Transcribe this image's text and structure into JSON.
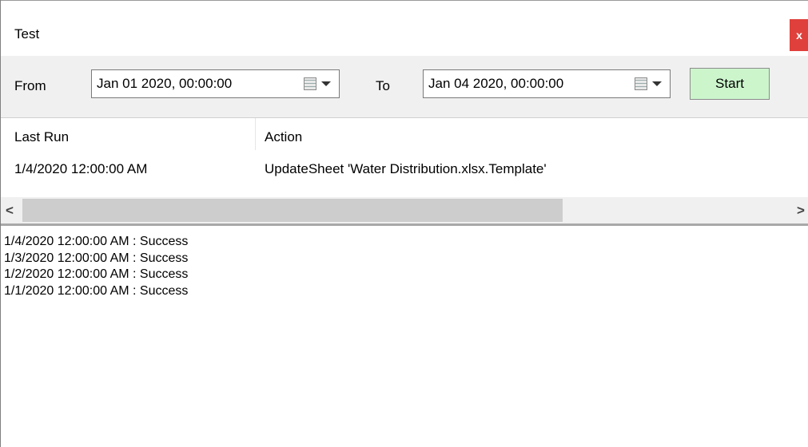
{
  "window": {
    "title": "Test",
    "close_label": "x"
  },
  "toolbar": {
    "from_label": "From",
    "from_value": "Jan  01 2020, 00:00:00",
    "to_label": "To",
    "to_value": "Jan  04 2020, 00:00:00",
    "start_label": "Start"
  },
  "grid": {
    "columns": [
      "Last Run",
      "Action"
    ],
    "rows": [
      {
        "last_run": "1/4/2020 12:00:00 AM",
        "action": "UpdateSheet 'Water Distribution.xlsx.Template'"
      }
    ]
  },
  "scrollbar": {
    "left_arrow": "<",
    "right_arrow": ">"
  },
  "log": {
    "lines": [
      "1/4/2020 12:00:00 AM : Success",
      "1/3/2020 12:00:00 AM : Success",
      "1/2/2020 12:00:00 AM : Success",
      "1/1/2020 12:00:00 AM : Success"
    ]
  }
}
